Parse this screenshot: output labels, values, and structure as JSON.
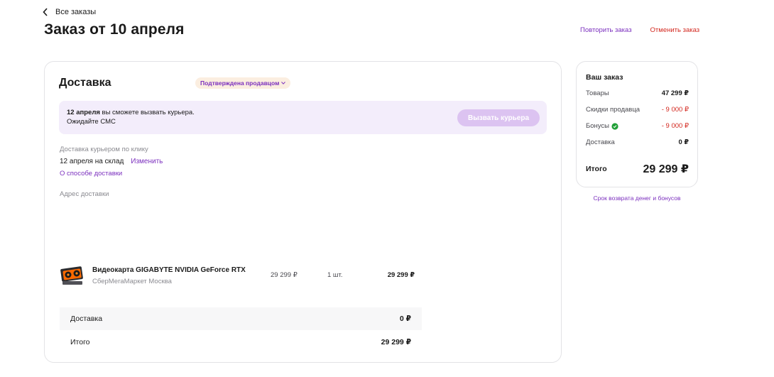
{
  "header": {
    "back_label": "Все заказы",
    "title": "Заказ от 10 апреля",
    "repeat_label": "Повторить заказ",
    "cancel_label": "Отменить заказ"
  },
  "delivery": {
    "title": "Доставка",
    "status": "Подтверждена продавцом",
    "banner": {
      "date": "12 апреля",
      "line1_rest": " вы сможете вызвать курьера.",
      "line2": "Ожидайте СМС",
      "button_label": "Вызвать курьера"
    },
    "method_label": "Доставка курьером по клику",
    "date_text": "12 апреля на склад",
    "change_label": "Изменить",
    "info_link": "О способе доставки",
    "address_label": "Адрес доставки"
  },
  "items": [
    {
      "name": "Видеокарта GIGABYTE NVIDIA GeForce RTX",
      "seller": "СберМегаМаркет Москва",
      "price": "29 299 ₽",
      "qty": "1 шт.",
      "total": "29 299 ₽"
    }
  ],
  "totals": {
    "delivery_label": "Доставка",
    "delivery_value": "0 ₽",
    "total_label": "Итого",
    "total_value": "29 299 ₽"
  },
  "summary": {
    "title": "Ваш заказ",
    "goods_label": "Товары",
    "goods_value": "47 299 ₽",
    "discount_label": "Скидки продавца",
    "discount_value": "- 9 000 ₽",
    "bonus_label": "Бонусы",
    "bonus_value": "- 9 000 ₽",
    "delivery_label": "Доставка",
    "delivery_value": "0 ₽",
    "total_label": "Итого",
    "total_value": "29 299 ₽",
    "refund_link": "Срок возврата денег и бонусов"
  },
  "colors": {
    "accent": "#7b2fbe",
    "danger": "#d3281f",
    "banner_bg": "#f3edfb",
    "badge_bg": "#fbeee0"
  }
}
